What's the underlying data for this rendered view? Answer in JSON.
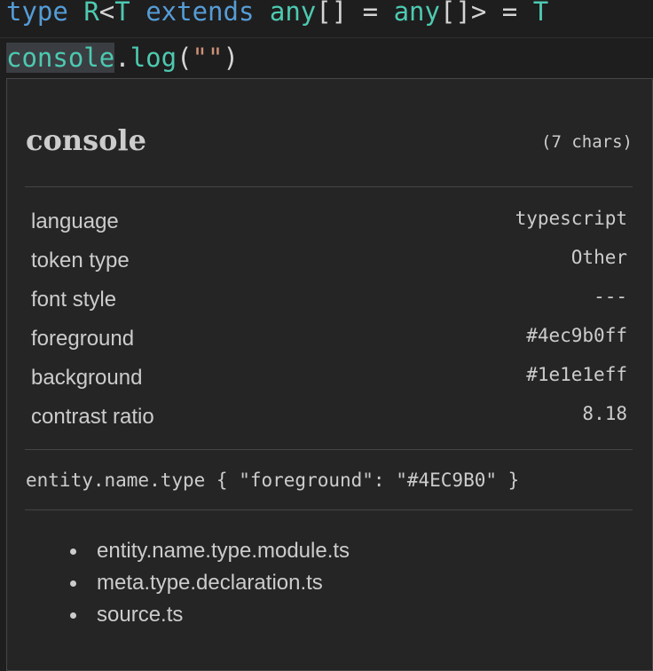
{
  "editor": {
    "line1": [
      {
        "text": "type",
        "color": "#569cd6"
      },
      {
        "text": " ",
        "color": "#d4d4d4"
      },
      {
        "text": "R",
        "color": "#4ec9b0"
      },
      {
        "text": "<",
        "color": "#d4d4d4"
      },
      {
        "text": "T",
        "color": "#4ec9b0"
      },
      {
        "text": " ",
        "color": "#d4d4d4"
      },
      {
        "text": "extends",
        "color": "#569cd6"
      },
      {
        "text": " ",
        "color": "#d4d4d4"
      },
      {
        "text": "any",
        "color": "#4ec9b0"
      },
      {
        "text": "[] = ",
        "color": "#d4d4d4"
      },
      {
        "text": "any",
        "color": "#4ec9b0"
      },
      {
        "text": "[]> = ",
        "color": "#d4d4d4"
      },
      {
        "text": "T",
        "color": "#4ec9b0"
      }
    ],
    "line2": [
      {
        "text": "console",
        "color": "#4ec9b0",
        "highlight": true
      },
      {
        "text": ".",
        "color": "#d4d4d4"
      },
      {
        "text": "log",
        "color": "#4ec9b0"
      },
      {
        "text": "(",
        "color": "#d4d4d4"
      },
      {
        "text": "\"\"",
        "color": "#ce9178"
      },
      {
        "text": ")",
        "color": "#d4d4d4"
      }
    ]
  },
  "inspector": {
    "token": "console",
    "char_count": "(7 chars)",
    "properties": [
      {
        "label": "language",
        "value": "typescript"
      },
      {
        "label": "token type",
        "value": "Other"
      },
      {
        "label": "font style",
        "value": "---"
      },
      {
        "label": "foreground",
        "value": "#4ec9b0ff"
      },
      {
        "label": "background",
        "value": "#1e1e1eff"
      },
      {
        "label": "contrast ratio",
        "value": "8.18"
      }
    ],
    "theme_rule": "entity.name.type { \"foreground\": \"#4EC9B0\" }",
    "scopes": [
      "entity.name.type.module.ts",
      "meta.type.declaration.ts",
      "source.ts"
    ]
  },
  "colors": {
    "editor_background": "#1e1e1e",
    "widget_background": "#252526",
    "widget_border": "#454545",
    "text": "#cccccc",
    "keyword": "#569cd6",
    "type": "#4ec9b0",
    "string": "#ce9178"
  }
}
